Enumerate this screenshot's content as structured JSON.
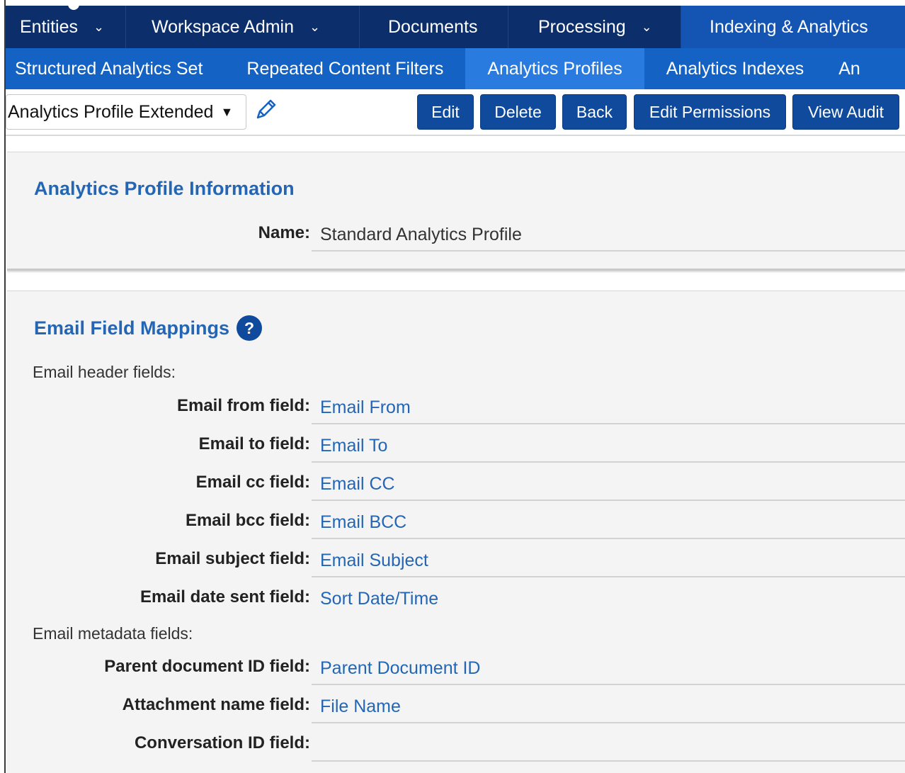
{
  "top_nav": {
    "items": [
      {
        "label": "Entities",
        "has_chevron": true
      },
      {
        "label": "Workspace Admin",
        "has_chevron": true
      },
      {
        "label": "Documents",
        "has_chevron": false
      },
      {
        "label": "Processing",
        "has_chevron": true
      },
      {
        "label": "Indexing & Analytics",
        "has_chevron": false,
        "active": true
      }
    ]
  },
  "sub_nav": {
    "items": [
      {
        "label": "Structured Analytics Set"
      },
      {
        "label": "Repeated Content Filters"
      },
      {
        "label": "Analytics Profiles",
        "active": true
      },
      {
        "label": "Analytics Indexes"
      },
      {
        "label": "An"
      }
    ]
  },
  "toolbar": {
    "layout_select": "Analytics Profile Extended",
    "buttons": {
      "edit": "Edit",
      "delete": "Delete",
      "back": "Back",
      "edit_permissions": "Edit Permissions",
      "view_audit": "View Audit"
    }
  },
  "profile_info": {
    "title": "Analytics Profile Information",
    "name_label": "Name:",
    "name_value": "Standard Analytics Profile"
  },
  "email_mappings": {
    "title": "Email Field Mappings",
    "help_glyph": "?",
    "header_section": "Email header fields:",
    "header_fields": [
      {
        "label": "Email from field:",
        "value": "Email From"
      },
      {
        "label": "Email to field:",
        "value": "Email To"
      },
      {
        "label": "Email cc field:",
        "value": "Email CC"
      },
      {
        "label": "Email bcc field:",
        "value": "Email BCC"
      },
      {
        "label": "Email subject field:",
        "value": "Email Subject"
      },
      {
        "label": "Email date sent field:",
        "value": "Sort Date/Time"
      }
    ],
    "metadata_section": "Email metadata fields:",
    "metadata_fields": [
      {
        "label": "Parent document ID field:",
        "value": "Parent Document ID"
      },
      {
        "label": "Attachment name field:",
        "value": "File Name"
      },
      {
        "label": "Conversation ID field:",
        "value": ""
      }
    ]
  },
  "glyphs": {
    "chevron": "⌄",
    "dropdown_arrow": "▼"
  },
  "colors": {
    "top_nav_bg": "#0c2f6b",
    "top_nav_active": "#1455b4",
    "sub_nav_bg": "#1463c4",
    "sub_nav_active": "#2a7be0",
    "button_bg": "#0f4a9c",
    "link_text": "#2466b4"
  }
}
